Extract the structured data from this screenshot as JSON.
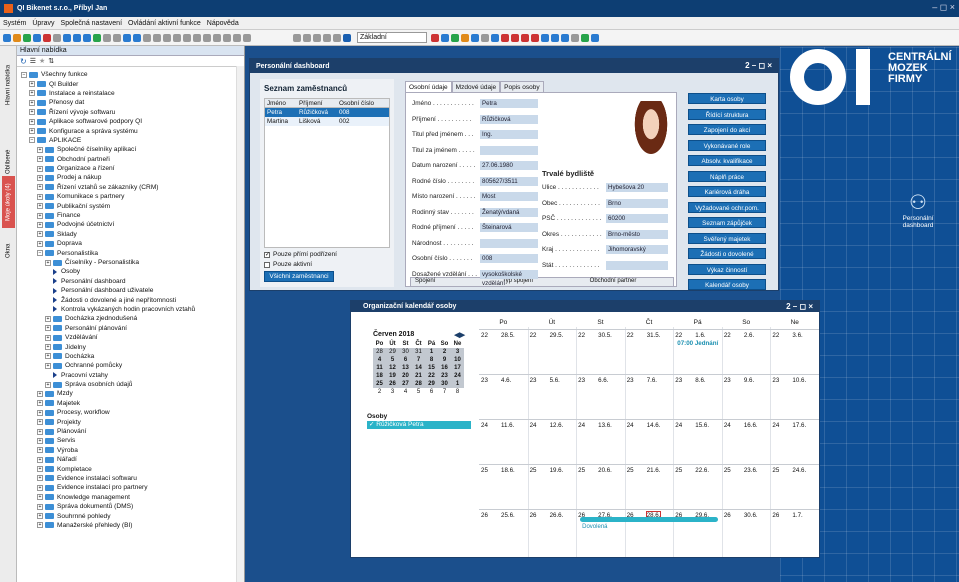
{
  "app": {
    "title": "QI Bikenet s.r.o., Příbyl Jan",
    "window_controls": "– ◻ ×"
  },
  "menu": [
    "Systém",
    "Úpravy",
    "Společná nastavení",
    "Ovládání aktivní funkce",
    "Nápověda"
  ],
  "toolbar": {
    "combo": "Základní"
  },
  "vtabs": [
    "Hlavní nabídka",
    "Oblíbené",
    "Moje úkoly (4)",
    "Okna"
  ],
  "nav": {
    "title": "Hlavní nabídka",
    "items": [
      [
        "−",
        "f",
        0,
        "Všechny funkce"
      ],
      [
        "+",
        "f",
        1,
        "QI Builder"
      ],
      [
        "+",
        "f",
        1,
        "Instalace a reinstalace"
      ],
      [
        "+",
        "f",
        1,
        "Přenosy dat"
      ],
      [
        "+",
        "f",
        1,
        "Řízení vývoje softwaru"
      ],
      [
        "+",
        "f",
        1,
        "Aplikace softwarové podpory QI"
      ],
      [
        "+",
        "f",
        1,
        "Konfigurace a správa systému"
      ],
      [
        "−",
        "f",
        1,
        "APLIKACE"
      ],
      [
        "+",
        "f",
        2,
        "Společné číselníky aplikací"
      ],
      [
        "+",
        "f",
        2,
        "Obchodní partneři"
      ],
      [
        "+",
        "f",
        2,
        "Organizace a řízení"
      ],
      [
        "+",
        "f",
        2,
        "Prodej a nákup"
      ],
      [
        "+",
        "f",
        2,
        "Řízení vztahů se zákazníky (CRM)"
      ],
      [
        "+",
        "f",
        2,
        "Komunikace s partnery"
      ],
      [
        "+",
        "f",
        2,
        "Publikační systém"
      ],
      [
        "+",
        "f",
        2,
        "Finance"
      ],
      [
        "+",
        "f",
        2,
        "Podvojné účetnictví"
      ],
      [
        "+",
        "f",
        2,
        "Sklady"
      ],
      [
        "+",
        "f",
        2,
        "Doprava"
      ],
      [
        "−",
        "f",
        2,
        "Personalistika"
      ],
      [
        "+",
        "f",
        3,
        "Číselníky - Personalistika"
      ],
      [
        "",
        "a",
        4,
        "Osoby"
      ],
      [
        "",
        "a",
        4,
        "Personální dashboard"
      ],
      [
        "",
        "a",
        4,
        "Personální dashboard uživatele"
      ],
      [
        "",
        "a",
        4,
        "Žádosti o dovolené a jiné nepřítomnosti"
      ],
      [
        "",
        "a",
        4,
        "Kontrola vykázaných hodin pracovních vztahů"
      ],
      [
        "+",
        "f",
        3,
        "Docházka zjednodušená"
      ],
      [
        "+",
        "f",
        3,
        "Personální plánování"
      ],
      [
        "+",
        "f",
        3,
        "Vzdělávání"
      ],
      [
        "+",
        "f",
        3,
        "Jídelny"
      ],
      [
        "+",
        "f",
        3,
        "Docházka"
      ],
      [
        "+",
        "f",
        3,
        "Ochranné pomůcky"
      ],
      [
        "",
        "a",
        4,
        "Pracovní vztahy"
      ],
      [
        "+",
        "f",
        3,
        "Správa osobních údajů"
      ],
      [
        "+",
        "f",
        2,
        "Mzdy"
      ],
      [
        "+",
        "f",
        2,
        "Majetek"
      ],
      [
        "+",
        "f",
        2,
        "Procesy, workflow"
      ],
      [
        "+",
        "f",
        2,
        "Projekty"
      ],
      [
        "+",
        "f",
        2,
        "Plánování"
      ],
      [
        "+",
        "f",
        2,
        "Servis"
      ],
      [
        "+",
        "f",
        2,
        "Výroba"
      ],
      [
        "+",
        "f",
        2,
        "Nářadí"
      ],
      [
        "+",
        "f",
        2,
        "Kompletace"
      ],
      [
        "+",
        "f",
        2,
        "Evidence instalací softwaru"
      ],
      [
        "+",
        "f",
        2,
        "Evidence instalací pro partnery"
      ],
      [
        "+",
        "f",
        2,
        "Knowledge management"
      ],
      [
        "+",
        "f",
        2,
        "Správa dokumentů (DMS)"
      ],
      [
        "+",
        "f",
        2,
        "Souhrnné pohledy"
      ],
      [
        "+",
        "f",
        2,
        "Manažerské přehledy (BI)"
      ]
    ]
  },
  "dash": {
    "title": "Personální dashboard",
    "window_controls": "2 – ◻ ×",
    "emp_title": "Seznam zaměstnanců",
    "cols": [
      "Jméno",
      "Příjmení",
      "Osobní číslo"
    ],
    "rows": [
      [
        "Petra",
        "Růžičková",
        "008"
      ],
      [
        "Martina",
        "Lišková",
        "002"
      ]
    ],
    "chk1": "Pouze přímí podřízení",
    "chk2": "Pouze aktivní",
    "btn_all": "Všichni zaměstnanci",
    "tabs": [
      "Osobní údaje",
      "Mzdové údaje",
      "Popis osoby"
    ],
    "fields": [
      [
        "Jméno . . . . . . . . . . . .",
        "Petra"
      ],
      [
        "Příjmení . . . . . . . . . .",
        "Růžičková"
      ],
      [
        "Titul před jménem . . .",
        "Ing."
      ],
      [
        "Titul za jménem . . . . .",
        ""
      ],
      [
        "Datum narození . . . . .",
        "27.06.1980"
      ],
      [
        "Rodné číslo . . . . . . . .",
        "805627/3511"
      ],
      [
        "Místo narození . . . . . .",
        "Most"
      ],
      [
        "Rodinný stav . . . . . . .",
        "Ženatý/vdaná"
      ],
      [
        "Rodné příjmení . . . . .",
        "Šteinarová"
      ],
      [
        "Národnost . . . . . . . . .",
        ""
      ],
      [
        "Osobní číslo . . . . . . .",
        "008"
      ],
      [
        "Dosažené vzdělání . . .",
        "vysokoškolské vzdělání"
      ]
    ],
    "addr_title": "Trvalé bydliště",
    "addr": [
      [
        "Ulice . . . . . . . . . . . .",
        "Hybešova 20"
      ],
      [
        "Obec . . . . . . . . . . . .",
        "Brno"
      ],
      [
        "PSČ . . . . . . . . . . . . .",
        "60200"
      ],
      [
        "Okres . . . . . . . . . . . .",
        "Brno-město"
      ],
      [
        "Kraj . . . . . . . . . . . . .",
        "Jihomoravský"
      ],
      [
        "Stát . . . . . . . . . . . . .",
        ""
      ]
    ],
    "rel_cols": [
      "Spojení",
      "Typ spojení",
      "Obchodní partner"
    ],
    "buttons": [
      "Karta osoby",
      "Řídící struktura",
      "Zapojení do akcí",
      "Vykonávané role",
      "Absolv. kvalifikace",
      "Náplň práce",
      "Kariérová dráha",
      "Vyžadované ochr.pom.",
      "Seznam zápůjček",
      "Svěřený majetek",
      "Žádosti o dovolené",
      "Výkaz činností",
      "Kalendář osoby"
    ]
  },
  "logo": {
    "text": [
      "CENTRÁLNÍ",
      "MOZEK",
      "FIRMY"
    ],
    "tile": "Personální dashboard"
  },
  "cal": {
    "title": "Organizační kalendář osoby",
    "window_controls": "2 – ◻ ×",
    "month": "Červen 2018",
    "dow": [
      "Po",
      "Út",
      "St",
      "Čt",
      "Pá",
      "So",
      "Ne"
    ],
    "mini": [
      [
        "28",
        "29",
        "30",
        "31",
        "1",
        "2",
        "3"
      ],
      [
        "4",
        "5",
        "6",
        "7",
        "8",
        "9",
        "10"
      ],
      [
        "11",
        "12",
        "13",
        "14",
        "15",
        "16",
        "17"
      ],
      [
        "18",
        "19",
        "20",
        "21",
        "22",
        "23",
        "24"
      ],
      [
        "25",
        "26",
        "27",
        "28",
        "29",
        "30",
        "1"
      ],
      [
        "2",
        "3",
        "4",
        "5",
        "6",
        "7",
        "8"
      ]
    ],
    "persons_label": "Osoby",
    "person": "Růžičková Petra",
    "weeks": [
      [
        "28.5.",
        "29.5.",
        "30.5.",
        "31.5.",
        "1.6.",
        "2.6.",
        "3.6."
      ],
      [
        "4.6.",
        "5.6.",
        "6.6.",
        "7.6.",
        "8.6.",
        "9.6.",
        "10.6."
      ],
      [
        "11.6.",
        "12.6.",
        "13.6.",
        "14.6.",
        "15.6.",
        "16.6.",
        "17.6."
      ],
      [
        "18.6.",
        "19.6.",
        "20.6.",
        "21.6.",
        "22.6.",
        "23.6.",
        "24.6."
      ],
      [
        "25.6.",
        "26.6.",
        "27.6.",
        "28.6.",
        "29.6.",
        "30.6.",
        "1.7."
      ]
    ],
    "weeknum": [
      "22",
      "23",
      "24",
      "25",
      "26"
    ],
    "event": "07:00 Jednání",
    "absence": "Dovolená"
  }
}
